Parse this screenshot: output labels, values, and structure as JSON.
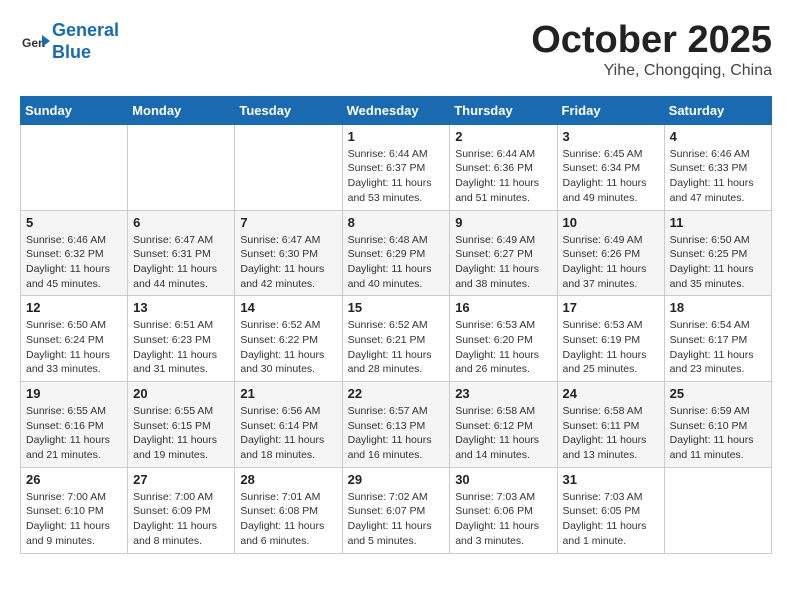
{
  "header": {
    "logo_line1": "General",
    "logo_line2": "Blue",
    "month": "October 2025",
    "location": "Yihe, Chongqing, China"
  },
  "weekdays": [
    "Sunday",
    "Monday",
    "Tuesday",
    "Wednesday",
    "Thursday",
    "Friday",
    "Saturday"
  ],
  "weeks": [
    [
      {
        "day": "",
        "info": ""
      },
      {
        "day": "",
        "info": ""
      },
      {
        "day": "",
        "info": ""
      },
      {
        "day": "1",
        "info": "Sunrise: 6:44 AM\nSunset: 6:37 PM\nDaylight: 11 hours\nand 53 minutes."
      },
      {
        "day": "2",
        "info": "Sunrise: 6:44 AM\nSunset: 6:36 PM\nDaylight: 11 hours\nand 51 minutes."
      },
      {
        "day": "3",
        "info": "Sunrise: 6:45 AM\nSunset: 6:34 PM\nDaylight: 11 hours\nand 49 minutes."
      },
      {
        "day": "4",
        "info": "Sunrise: 6:46 AM\nSunset: 6:33 PM\nDaylight: 11 hours\nand 47 minutes."
      }
    ],
    [
      {
        "day": "5",
        "info": "Sunrise: 6:46 AM\nSunset: 6:32 PM\nDaylight: 11 hours\nand 45 minutes."
      },
      {
        "day": "6",
        "info": "Sunrise: 6:47 AM\nSunset: 6:31 PM\nDaylight: 11 hours\nand 44 minutes."
      },
      {
        "day": "7",
        "info": "Sunrise: 6:47 AM\nSunset: 6:30 PM\nDaylight: 11 hours\nand 42 minutes."
      },
      {
        "day": "8",
        "info": "Sunrise: 6:48 AM\nSunset: 6:29 PM\nDaylight: 11 hours\nand 40 minutes."
      },
      {
        "day": "9",
        "info": "Sunrise: 6:49 AM\nSunset: 6:27 PM\nDaylight: 11 hours\nand 38 minutes."
      },
      {
        "day": "10",
        "info": "Sunrise: 6:49 AM\nSunset: 6:26 PM\nDaylight: 11 hours\nand 37 minutes."
      },
      {
        "day": "11",
        "info": "Sunrise: 6:50 AM\nSunset: 6:25 PM\nDaylight: 11 hours\nand 35 minutes."
      }
    ],
    [
      {
        "day": "12",
        "info": "Sunrise: 6:50 AM\nSunset: 6:24 PM\nDaylight: 11 hours\nand 33 minutes."
      },
      {
        "day": "13",
        "info": "Sunrise: 6:51 AM\nSunset: 6:23 PM\nDaylight: 11 hours\nand 31 minutes."
      },
      {
        "day": "14",
        "info": "Sunrise: 6:52 AM\nSunset: 6:22 PM\nDaylight: 11 hours\nand 30 minutes."
      },
      {
        "day": "15",
        "info": "Sunrise: 6:52 AM\nSunset: 6:21 PM\nDaylight: 11 hours\nand 28 minutes."
      },
      {
        "day": "16",
        "info": "Sunrise: 6:53 AM\nSunset: 6:20 PM\nDaylight: 11 hours\nand 26 minutes."
      },
      {
        "day": "17",
        "info": "Sunrise: 6:53 AM\nSunset: 6:19 PM\nDaylight: 11 hours\nand 25 minutes."
      },
      {
        "day": "18",
        "info": "Sunrise: 6:54 AM\nSunset: 6:17 PM\nDaylight: 11 hours\nand 23 minutes."
      }
    ],
    [
      {
        "day": "19",
        "info": "Sunrise: 6:55 AM\nSunset: 6:16 PM\nDaylight: 11 hours\nand 21 minutes."
      },
      {
        "day": "20",
        "info": "Sunrise: 6:55 AM\nSunset: 6:15 PM\nDaylight: 11 hours\nand 19 minutes."
      },
      {
        "day": "21",
        "info": "Sunrise: 6:56 AM\nSunset: 6:14 PM\nDaylight: 11 hours\nand 18 minutes."
      },
      {
        "day": "22",
        "info": "Sunrise: 6:57 AM\nSunset: 6:13 PM\nDaylight: 11 hours\nand 16 minutes."
      },
      {
        "day": "23",
        "info": "Sunrise: 6:58 AM\nSunset: 6:12 PM\nDaylight: 11 hours\nand 14 minutes."
      },
      {
        "day": "24",
        "info": "Sunrise: 6:58 AM\nSunset: 6:11 PM\nDaylight: 11 hours\nand 13 minutes."
      },
      {
        "day": "25",
        "info": "Sunrise: 6:59 AM\nSunset: 6:10 PM\nDaylight: 11 hours\nand 11 minutes."
      }
    ],
    [
      {
        "day": "26",
        "info": "Sunrise: 7:00 AM\nSunset: 6:10 PM\nDaylight: 11 hours\nand 9 minutes."
      },
      {
        "day": "27",
        "info": "Sunrise: 7:00 AM\nSunset: 6:09 PM\nDaylight: 11 hours\nand 8 minutes."
      },
      {
        "day": "28",
        "info": "Sunrise: 7:01 AM\nSunset: 6:08 PM\nDaylight: 11 hours\nand 6 minutes."
      },
      {
        "day": "29",
        "info": "Sunrise: 7:02 AM\nSunset: 6:07 PM\nDaylight: 11 hours\nand 5 minutes."
      },
      {
        "day": "30",
        "info": "Sunrise: 7:03 AM\nSunset: 6:06 PM\nDaylight: 11 hours\nand 3 minutes."
      },
      {
        "day": "31",
        "info": "Sunrise: 7:03 AM\nSunset: 6:05 PM\nDaylight: 11 hours\nand 1 minute."
      },
      {
        "day": "",
        "info": ""
      }
    ]
  ]
}
